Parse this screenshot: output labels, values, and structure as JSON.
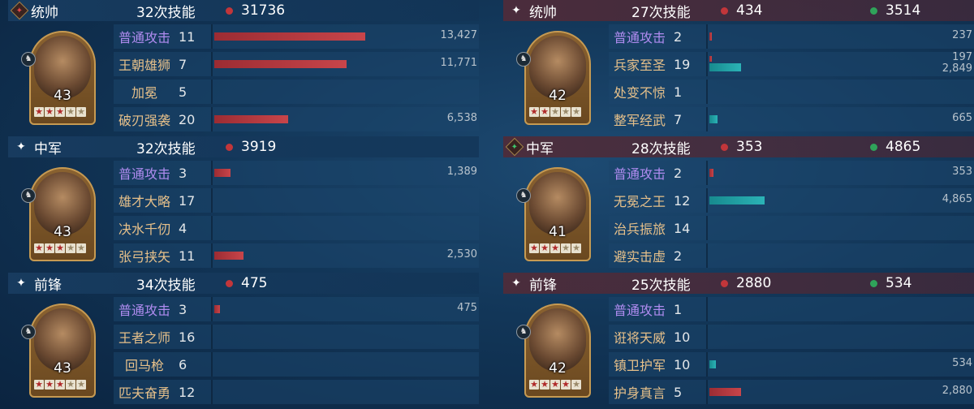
{
  "left": [
    {
      "role": "统帅",
      "role_icon": "badge-red",
      "casts": "32次技能",
      "damage": "31736",
      "heal": null,
      "level": "43",
      "stars": 3,
      "skills": [
        {
          "name": "普通攻击",
          "basic": true,
          "count": "11",
          "dmg": "13,427",
          "dmg_frac": 0.57,
          "heal": null,
          "heal_frac": 0
        },
        {
          "name": "王朝雄狮",
          "basic": false,
          "count": "7",
          "dmg": "11,771",
          "dmg_frac": 0.5,
          "heal": null,
          "heal_frac": 0
        },
        {
          "name": "加冕",
          "basic": false,
          "count": "5",
          "dmg": null,
          "dmg_frac": 0,
          "heal": null,
          "heal_frac": 0
        },
        {
          "name": "破刃强袭",
          "basic": false,
          "count": "20",
          "dmg": "6,538",
          "dmg_frac": 0.28,
          "heal": null,
          "heal_frac": 0
        }
      ]
    },
    {
      "role": "中军",
      "role_icon": "star",
      "casts": "32次技能",
      "damage": "3919",
      "heal": null,
      "level": "43",
      "stars": 3,
      "skills": [
        {
          "name": "普通攻击",
          "basic": true,
          "count": "3",
          "dmg": "1,389",
          "dmg_frac": 0.06,
          "heal": null,
          "heal_frac": 0
        },
        {
          "name": "雄才大略",
          "basic": false,
          "count": "17",
          "dmg": null,
          "dmg_frac": 0,
          "heal": null,
          "heal_frac": 0
        },
        {
          "name": "决水千仞",
          "basic": false,
          "count": "4",
          "dmg": null,
          "dmg_frac": 0,
          "heal": null,
          "heal_frac": 0
        },
        {
          "name": "张弓挟矢",
          "basic": false,
          "count": "11",
          "dmg": "2,530",
          "dmg_frac": 0.11,
          "heal": null,
          "heal_frac": 0
        }
      ]
    },
    {
      "role": "前锋",
      "role_icon": "star",
      "casts": "34次技能",
      "damage": "475",
      "heal": null,
      "level": "43",
      "stars": 3,
      "skills": [
        {
          "name": "普通攻击",
          "basic": true,
          "count": "3",
          "dmg": "475",
          "dmg_frac": 0.02,
          "heal": null,
          "heal_frac": 0
        },
        {
          "name": "王者之师",
          "basic": false,
          "count": "16",
          "dmg": null,
          "dmg_frac": 0,
          "heal": null,
          "heal_frac": 0
        },
        {
          "name": "回马枪",
          "basic": false,
          "count": "6",
          "dmg": null,
          "dmg_frac": 0,
          "heal": null,
          "heal_frac": 0
        },
        {
          "name": "匹夫奋勇",
          "basic": false,
          "count": "12",
          "dmg": null,
          "dmg_frac": 0,
          "heal": null,
          "heal_frac": 0
        }
      ]
    }
  ],
  "right": [
    {
      "role": "统帅",
      "role_icon": "star",
      "casts": "27次技能",
      "damage": "434",
      "heal": "3514",
      "level": "42",
      "stars": 2,
      "skills": [
        {
          "name": "普通攻击",
          "basic": true,
          "count": "2",
          "dmg": "237",
          "dmg_frac": 0.01,
          "heal": null,
          "heal_frac": 0
        },
        {
          "name": "兵家至圣",
          "basic": false,
          "count": "19",
          "dmg": "197",
          "dmg_frac": 0.008,
          "heal": "2,849",
          "heal_frac": 0.12
        },
        {
          "name": "处变不惊",
          "basic": false,
          "count": "1",
          "dmg": null,
          "dmg_frac": 0,
          "heal": null,
          "heal_frac": 0
        },
        {
          "name": "整军经武",
          "basic": false,
          "count": "7",
          "dmg": null,
          "dmg_frac": 0,
          "heal": "665",
          "heal_frac": 0.03
        }
      ]
    },
    {
      "role": "中军",
      "role_icon": "badge-green",
      "casts": "28次技能",
      "damage": "353",
      "heal": "4865",
      "level": "41",
      "stars": 3,
      "skills": [
        {
          "name": "普通攻击",
          "basic": true,
          "count": "2",
          "dmg": "353",
          "dmg_frac": 0.015,
          "heal": null,
          "heal_frac": 0
        },
        {
          "name": "无冕之王",
          "basic": false,
          "count": "12",
          "dmg": null,
          "dmg_frac": 0,
          "heal": "4,865",
          "heal_frac": 0.21
        },
        {
          "name": "治兵振旅",
          "basic": false,
          "count": "14",
          "dmg": null,
          "dmg_frac": 0,
          "heal": null,
          "heal_frac": 0
        },
        {
          "name": "避实击虚",
          "basic": false,
          "count": "2",
          "dmg": null,
          "dmg_frac": 0,
          "heal": null,
          "heal_frac": 0
        }
      ]
    },
    {
      "role": "前锋",
      "role_icon": "star",
      "casts": "25次技能",
      "damage": "2880",
      "heal": "534",
      "level": "42",
      "stars": 4,
      "skills": [
        {
          "name": "普通攻击",
          "basic": true,
          "count": "1",
          "dmg": null,
          "dmg_frac": 0,
          "heal": null,
          "heal_frac": 0
        },
        {
          "name": "诳将天威",
          "basic": false,
          "count": "10",
          "dmg": null,
          "dmg_frac": 0,
          "heal": null,
          "heal_frac": 0
        },
        {
          "name": "镇卫护军",
          "basic": false,
          "count": "10",
          "dmg": null,
          "dmg_frac": 0,
          "heal": "534",
          "heal_frac": 0.025
        },
        {
          "name": "护身真言",
          "basic": false,
          "count": "5",
          "dmg": "2,880",
          "dmg_frac": 0.12,
          "heal": null,
          "heal_frac": 0
        }
      ]
    }
  ],
  "colors": {
    "damage": "#c2363a",
    "heal": "#2fa35a",
    "damage_bar": "#c8454a",
    "heal_bar": "#2bb3b6",
    "basic_skill": "#b08cf0",
    "skill": "#e6c08a"
  }
}
